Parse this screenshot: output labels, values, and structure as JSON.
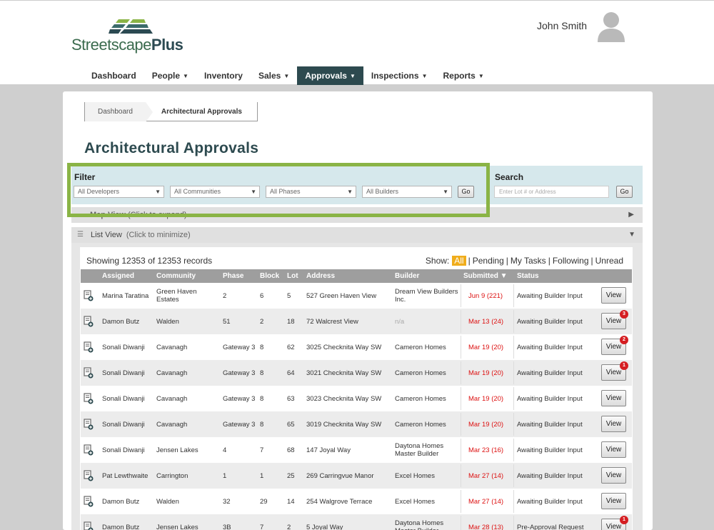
{
  "brand": {
    "name_regular": "Streetscape",
    "name_bold": "Plus"
  },
  "user": {
    "name": "John Smith"
  },
  "nav": {
    "items": [
      {
        "label": "Dashboard",
        "caret": ""
      },
      {
        "label": "People",
        "caret": "▼"
      },
      {
        "label": "Inventory",
        "caret": ""
      },
      {
        "label": "Sales",
        "caret": "▼"
      },
      {
        "label": "Approvals",
        "caret": "▼"
      },
      {
        "label": "Inspections",
        "caret": "▼"
      },
      {
        "label": "Reports",
        "caret": "▼"
      }
    ]
  },
  "breadcrumb": {
    "home": "Dashboard",
    "current": "Architectural Approvals"
  },
  "page_title": "Architectural Approvals",
  "filter": {
    "label": "Filter",
    "developers": "All Developers",
    "communities": "All Communities",
    "phases": "All Phases",
    "builders": "All Builders",
    "go": "Go"
  },
  "search": {
    "label": "Search",
    "placeholder": "Enter Lot # or Address",
    "go": "Go"
  },
  "map_view": {
    "label": "Map View",
    "hint": "(Click to expand)"
  },
  "list_view": {
    "label": "List View",
    "hint": "(Click to minimize)"
  },
  "records": {
    "showing": "Showing 12353 of 12353 records"
  },
  "show_tabs": {
    "label": "Show:",
    "all": "All",
    "pending": "Pending",
    "my_tasks": "My Tasks",
    "following": "Following",
    "unread": "Unread"
  },
  "table": {
    "headers": {
      "assigned": "Assigned",
      "community": "Community",
      "phase": "Phase",
      "block": "Block",
      "lot": "Lot",
      "address": "Address",
      "builder": "Builder",
      "submitted": "Submitted ▼",
      "status": "Status"
    },
    "view_label": "View",
    "rows": [
      {
        "assigned": "Marina Taratina",
        "community": "Green Haven Estates",
        "phase": "2",
        "block": "6",
        "lot": "5",
        "address": "527 Green Haven View",
        "builder": "Dream View Builders Inc.",
        "submitted": "Jun 9 (221)",
        "status": "Awaiting Builder Input",
        "badge": ""
      },
      {
        "assigned": "Damon Butz",
        "community": "Walden",
        "phase": "51",
        "block": "2",
        "lot": "18",
        "address": "72 Walcrest View",
        "builder": "n/a",
        "submitted": "Mar 13 (24)",
        "status": "Awaiting Builder Input",
        "badge": "3"
      },
      {
        "assigned": "Sonali Diwanji",
        "community": "Cavanagh",
        "phase": "Gateway 3",
        "block": "8",
        "lot": "62",
        "address": "3025 Checknita Way SW",
        "builder": "Cameron Homes",
        "submitted": "Mar 19 (20)",
        "status": "Awaiting Builder Input",
        "badge": "2"
      },
      {
        "assigned": "Sonali Diwanji",
        "community": "Cavanagh",
        "phase": "Gateway 3",
        "block": "8",
        "lot": "64",
        "address": "3021 Checknita Way SW",
        "builder": "Cameron Homes",
        "submitted": "Mar 19 (20)",
        "status": "Awaiting Builder Input",
        "badge": "1"
      },
      {
        "assigned": "Sonali Diwanji",
        "community": "Cavanagh",
        "phase": "Gateway 3",
        "block": "8",
        "lot": "63",
        "address": "3023 Checknita Way SW",
        "builder": "Cameron Homes",
        "submitted": "Mar 19 (20)",
        "status": "Awaiting Builder Input",
        "badge": ""
      },
      {
        "assigned": "Sonali Diwanji",
        "community": "Cavanagh",
        "phase": "Gateway 3",
        "block": "8",
        "lot": "65",
        "address": "3019 Checknita Way SW",
        "builder": "Cameron Homes",
        "submitted": "Mar 19 (20)",
        "status": "Awaiting Builder Input",
        "badge": ""
      },
      {
        "assigned": "Sonali Diwanji",
        "community": "Jensen Lakes",
        "phase": "4",
        "block": "7",
        "lot": "68",
        "address": "147 Joyal Way",
        "builder": "Daytona Homes Master Builder",
        "submitted": "Mar 23 (16)",
        "status": "Awaiting Builder Input",
        "badge": ""
      },
      {
        "assigned": "Pat Lewthwaite",
        "community": "Carrington",
        "phase": "1",
        "block": "1",
        "lot": "25",
        "address": "269 Carringvue Manor",
        "builder": "Excel Homes",
        "submitted": "Mar 27 (14)",
        "status": "Awaiting Builder Input",
        "badge": ""
      },
      {
        "assigned": "Damon Butz",
        "community": "Walden",
        "phase": "32",
        "block": "29",
        "lot": "14",
        "address": "254 Walgrove Terrace",
        "builder": "Excel Homes",
        "submitted": "Mar 27 (14)",
        "status": "Awaiting Builder Input",
        "badge": ""
      },
      {
        "assigned": "Damon Butz",
        "community": "Jensen Lakes",
        "phase": "3B",
        "block": "7",
        "lot": "2",
        "address": "5 Joyal Way",
        "builder": "Daytona Homes Master Builder",
        "submitted": "Mar 28 (13)",
        "status": "Pre-Approval Request",
        "badge": "1"
      }
    ]
  },
  "colors": {
    "nav_active": "#2d4a4f",
    "filter_highlight": "#8ab446",
    "filter_band": "#d6e8ec",
    "date_red": "#dd1111",
    "badge_red": "#d51e22",
    "tab_active": "#f0ad1c"
  },
  "icons": {
    "avatar": "user-avatar-icon",
    "row_icon": "document-add-icon",
    "list": "list-icon",
    "map": "map-marker-icon"
  }
}
